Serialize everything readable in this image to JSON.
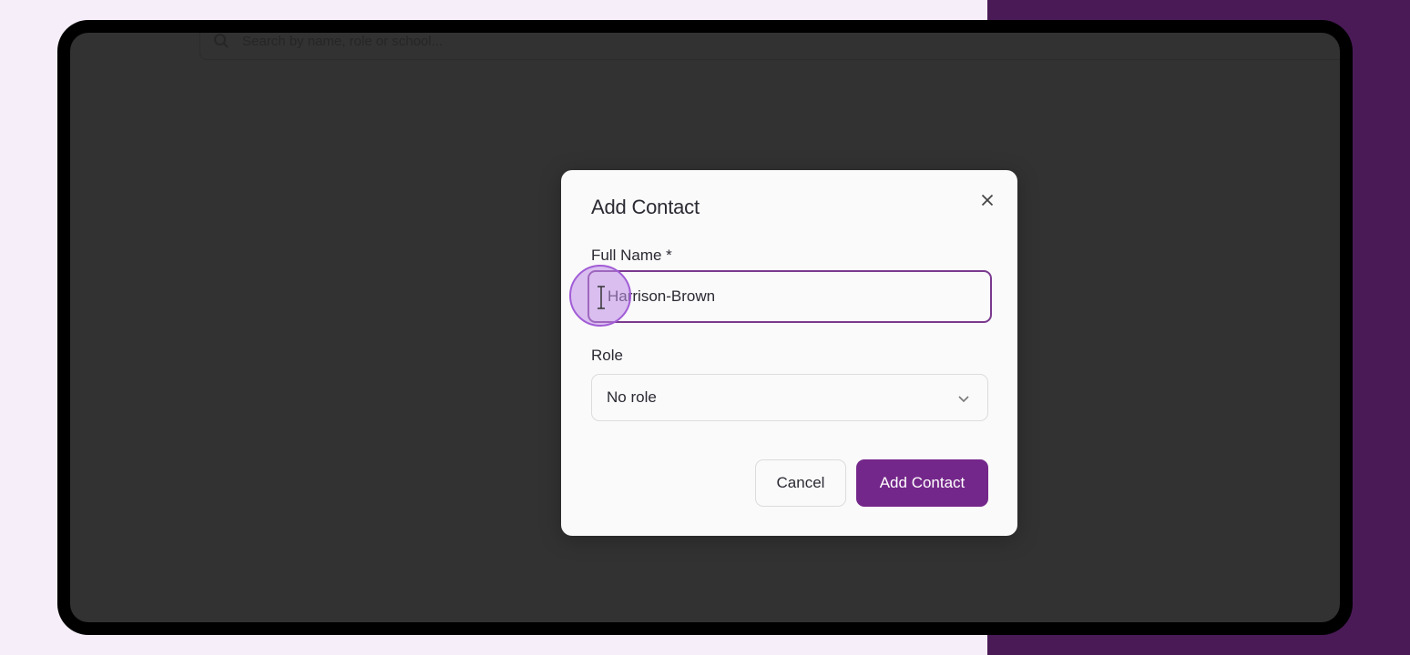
{
  "search": {
    "placeholder": "Search by name, role or school..."
  },
  "modal": {
    "title": "Add Contact",
    "full_name_label": "Full Name *",
    "full_name_value": "Harrison-Brown",
    "role_label": "Role",
    "role_value": "No role",
    "cancel_label": "Cancel",
    "submit_label": "Add Contact"
  },
  "colors": {
    "accent": "#74278a",
    "input_focus_border": "#7a3a8e",
    "overlay": "#323232",
    "right_panel": "#4a1a57"
  },
  "icons": {
    "close": "close-icon",
    "dropdown": "chevron-down-icon",
    "search": "search-icon",
    "cursor": "text-cursor-icon"
  }
}
